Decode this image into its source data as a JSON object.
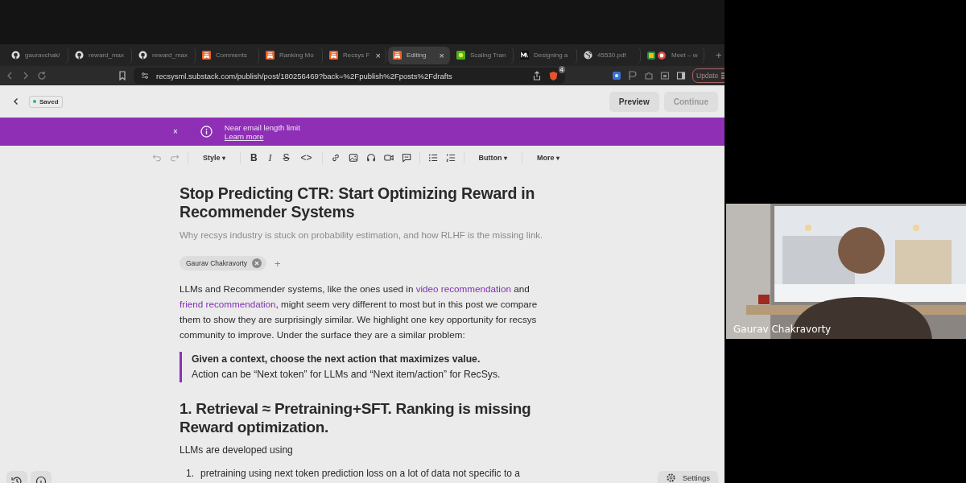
{
  "browser": {
    "tabs": [
      {
        "title": "gauravchak/",
        "kind": "github",
        "selected": false,
        "closable": false
      },
      {
        "title": "reward_max",
        "kind": "github",
        "selected": false,
        "closable": false
      },
      {
        "title": "reward_max",
        "kind": "github",
        "selected": false,
        "closable": false
      },
      {
        "title": "Comments",
        "kind": "substack",
        "selected": false,
        "closable": false
      },
      {
        "title": "Ranking Mo",
        "kind": "substack",
        "selected": false,
        "closable": false
      },
      {
        "title": "Recsys F",
        "kind": "substack",
        "selected": false,
        "closable": true
      },
      {
        "title": "Editing",
        "kind": "substack",
        "selected": true,
        "closable": true
      },
      {
        "title": "Scaling Tran",
        "kind": "green",
        "selected": false,
        "closable": false
      },
      {
        "title": "Designing a",
        "kind": "mark",
        "selected": false,
        "closable": false
      },
      {
        "title": "45530.pdf",
        "kind": "globe",
        "selected": false,
        "closable": false
      },
      {
        "title": "Meet – w",
        "kind": "meet",
        "selected": false,
        "closable": false
      }
    ],
    "close_glyph": "×",
    "new_tab_glyph": "+",
    "url": "recsysml.substack.com/publish/post/180256469?back=%2Fpublish%2Fposts%2Fdrafts",
    "shield_badge": "4",
    "update_button": "Update"
  },
  "editor": {
    "status": "Saved",
    "preview_button": "Preview",
    "continue_button": "Continue",
    "banner": {
      "close": "×",
      "message": "Near email length limit",
      "link": "Learn more"
    },
    "toolbar": {
      "caret": "▾",
      "style_menu": "Style",
      "glyphs": [
        "B",
        "I",
        "S",
        "<>"
      ],
      "button_menu": "Button",
      "more_menu": "More"
    },
    "title": "Stop Predicting CTR: Start Optimizing Reward in Recommender Systems",
    "subtitle": "Why recsys industry is stuck on probability estimation, and how RLHF is the missing link.",
    "author": "Gaurav Chakravorty",
    "add_author": "+",
    "intro": [
      {
        "text": "LLMs and Recommender systems, like the ones used in ",
        "link": false
      },
      {
        "text": "video recommendation",
        "link": true
      },
      {
        "text": " and ",
        "link": false
      },
      {
        "text": "friend recommendation",
        "link": true
      },
      {
        "text": ", might seem very different to most but in this post we compare them to show they are surprisingly similar. We highlight one key opportunity for recsys community to improve. Under the surface they are a similar problem:",
        "link": false
      }
    ],
    "quote": {
      "strong": "Given a context, choose the next action that maximizes value.",
      "text": "Action can be “Next token” for LLMs and “Next item/action” for RecSys."
    },
    "heading": "1. Retrieval ≈ Pretraining+SFT. Ranking is missing Reward optimization.",
    "paragraph": "LLMs are developed using",
    "list": [
      {
        "number": "1.",
        "text": "pretraining using next token prediction loss on a lot of data not specific to a"
      }
    ],
    "settings_button": "Settings"
  },
  "video": {
    "participant": "Gaurav Chakravorty"
  }
}
